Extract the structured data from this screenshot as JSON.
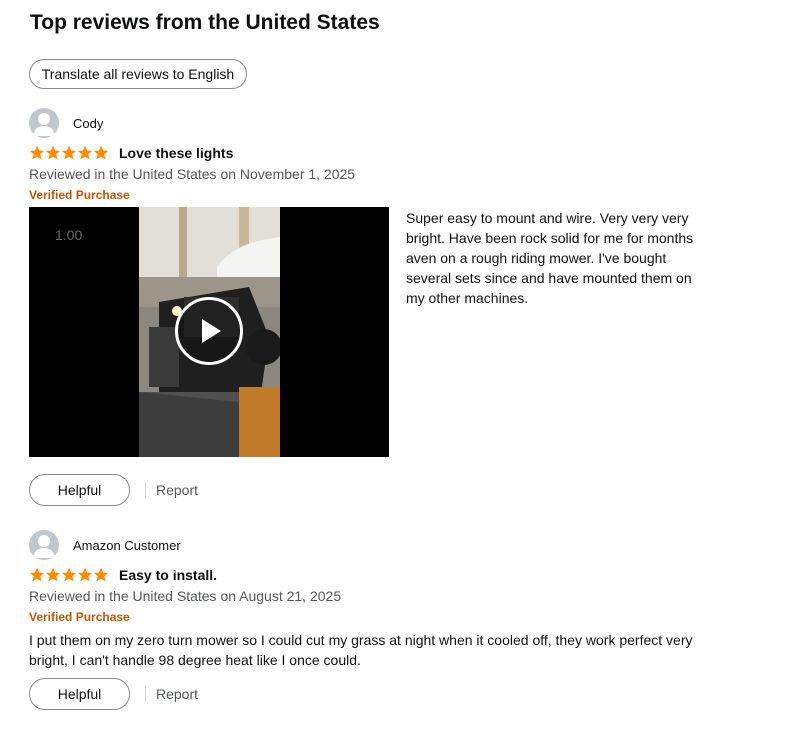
{
  "section": {
    "title": "Top reviews from the United States",
    "translate_label": "Translate all reviews to English"
  },
  "colors": {
    "star": "#ff8c00",
    "verified": "#c45500",
    "avatar": "#c1c8cd"
  },
  "reviews": [
    {
      "reviewer": "Cody",
      "rating": 5,
      "headline": "Love these lights",
      "date": "Reviewed in the United States on November 1, 2025",
      "verified": "Verified Purchase",
      "video": {
        "speed": "1.00"
      },
      "body": "Super easy to mount and wire. Very very very bright. Have been rock solid for me for months aven on a rough riding mower. I've bought several sets since and have mounted them on my other machines.",
      "helpful_label": "Helpful",
      "report_label": "Report"
    },
    {
      "reviewer": "Amazon Customer",
      "rating": 5,
      "headline": "Easy to install.",
      "date": "Reviewed in the United States on August 21, 2025",
      "verified": "Verified Purchase",
      "body": "I put them on my zero turn mower so I could cut my grass at night when it cooled off, they work perfect very bright, I can't handle 98 degree heat like I once could.",
      "helpful_label": "Helpful",
      "report_label": "Report"
    }
  ]
}
